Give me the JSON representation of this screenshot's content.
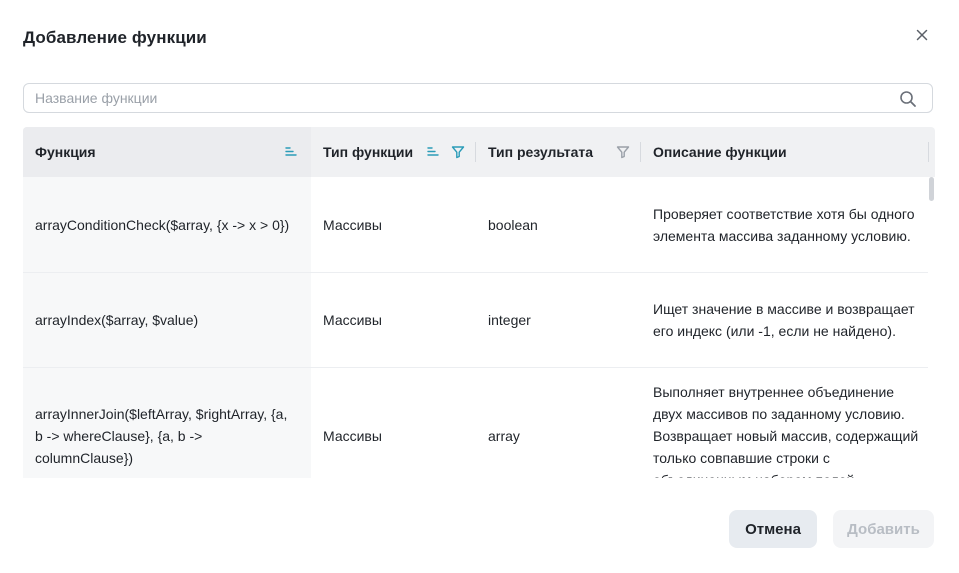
{
  "dialog": {
    "title": "Добавление функции",
    "close_icon": "close-icon"
  },
  "search": {
    "placeholder": "Название функции",
    "value": "",
    "icon": "search-icon"
  },
  "table": {
    "columns": [
      {
        "label": "Функция",
        "icons": [
          "sort-icon"
        ]
      },
      {
        "label": "Тип функции",
        "icons": [
          "sort-icon",
          "filter-icon"
        ]
      },
      {
        "label": "Тип результата",
        "icons": [
          "filter-icon"
        ]
      },
      {
        "label": "Описание функции",
        "icons": []
      }
    ],
    "rows": [
      {
        "function": "arrayConditionCheck($array, {x -> x > 0})",
        "type": "Массивы",
        "result": "boolean",
        "description": "Проверяет соответствие хотя бы одного элемента массива заданному условию."
      },
      {
        "function": "arrayIndex($array, $value)",
        "type": "Массивы",
        "result": "integer",
        "description": "Ищет значение в массиве и возвращает его индекс (или -1, если не найдено)."
      },
      {
        "function": "arrayInnerJoin($leftArray, $rightArray, {a, b -> whereClause}, {a, b -> columnClause})",
        "type": "Массивы",
        "result": "array",
        "description": "Выполняет внутреннее объединение двух массивов по заданному условию. Возвращает новый массив, содержащий только совпавшие строки с объединенным набором полей."
      }
    ]
  },
  "footer": {
    "cancel_label": "Отмена",
    "add_label": "Добавить"
  },
  "colors": {
    "header_bg": "#f0f1f3",
    "accent": "#2a9cb8",
    "border": "#d5d9de"
  }
}
